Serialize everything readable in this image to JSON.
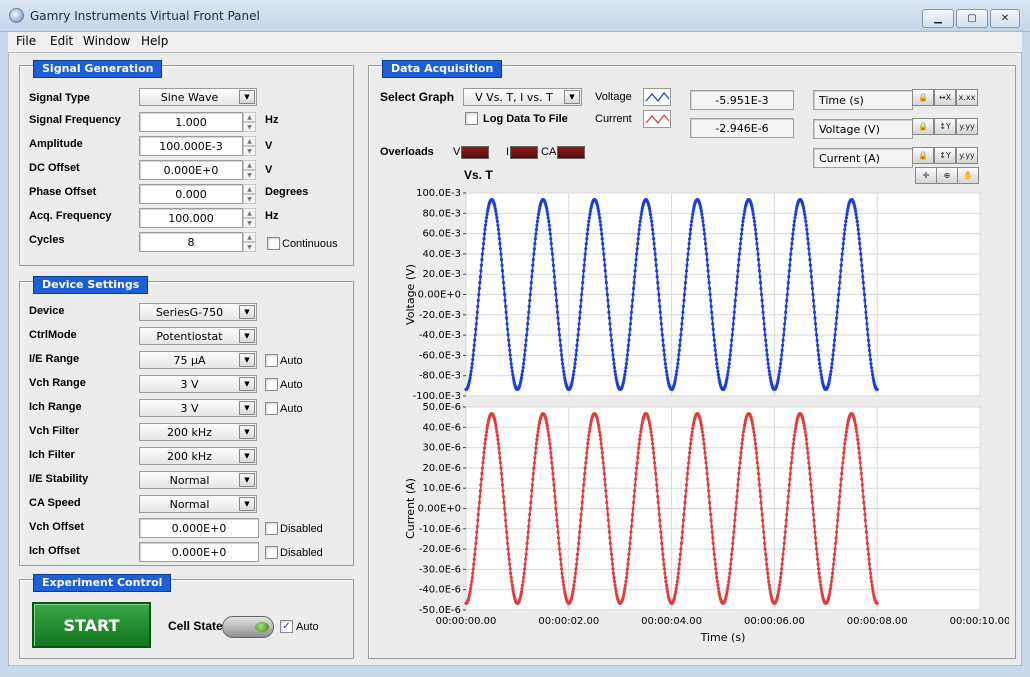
{
  "window": {
    "title": "Gamry Instruments Virtual Front Panel"
  },
  "menu": [
    "File",
    "Edit",
    "Window",
    "Help"
  ],
  "signal_generation": {
    "title": "Signal Generation",
    "signal_type": {
      "label": "Signal Type",
      "value": "Sine Wave"
    },
    "frequency": {
      "label": "Signal Frequency",
      "value": "1.000",
      "unit": "Hz"
    },
    "amplitude": {
      "label": "Amplitude",
      "value": "100.000E-3",
      "unit": "V"
    },
    "dc_offset": {
      "label": "DC Offset",
      "value": "0.000E+0",
      "unit": "V"
    },
    "phase_offset": {
      "label": "Phase Offset",
      "value": "0.000",
      "unit": "Degrees"
    },
    "acq_frequency": {
      "label": "Acq. Frequency",
      "value": "100.000",
      "unit": "Hz"
    },
    "cycles": {
      "label": "Cycles",
      "value": "8",
      "continuous_label": "Continuous"
    }
  },
  "device_settings": {
    "title": "Device Settings",
    "rows": [
      {
        "label": "Device",
        "value": "SeriesG-750",
        "type": "ring"
      },
      {
        "label": "CtrlMode",
        "value": "Potentiostat",
        "type": "ring"
      },
      {
        "label": "I/E Range",
        "value": "75 µA",
        "type": "ring",
        "check": "Auto"
      },
      {
        "label": "Vch Range",
        "value": "3 V",
        "type": "ring",
        "check": "Auto"
      },
      {
        "label": "Ich Range",
        "value": "3 V",
        "type": "ring",
        "check": "Auto"
      },
      {
        "label": "Vch Filter",
        "value": "200 kHz",
        "type": "ring"
      },
      {
        "label": "Ich Filter",
        "value": "200 kHz",
        "type": "ring"
      },
      {
        "label": "I/E Stability",
        "value": "Normal",
        "type": "ring"
      },
      {
        "label": "CA Speed",
        "value": "Normal",
        "type": "ring"
      },
      {
        "label": "Vch Offset",
        "value": "0.000E+0",
        "type": "num",
        "check": "Disabled"
      },
      {
        "label": "Ich Offset",
        "value": "0.000E+0",
        "type": "num",
        "check": "Disabled"
      }
    ]
  },
  "experiment_control": {
    "title": "Experiment Control",
    "start_label": "START",
    "cell_state_label": "Cell State",
    "auto_label": "Auto",
    "auto_checked": true
  },
  "data_acquisition": {
    "title": "Data Acquisition",
    "select_graph_label": "Select Graph",
    "select_graph_value": "V Vs. T, I vs. T",
    "log_label": "Log Data To File",
    "voltage_label": "Voltage",
    "current_label": "Current",
    "voltage_value": "-5.951E-3",
    "current_value": "-2.946E-6",
    "overloads_label": "Overloads",
    "overload_v": "V",
    "overload_i": "I",
    "overload_ca": "CA",
    "graph_title": "Vs. T",
    "axis_time": "Time (s)",
    "axis_voltage": "Voltage (V)",
    "axis_current": "Current (A)",
    "tool_x": "x.xx",
    "tool_y": "y.yy",
    "voltage_color": "#1a3fd6",
    "current_color": "#e03c3c"
  },
  "chart_data": [
    {
      "type": "scatter",
      "ylabel": "Voltage (V)",
      "xlim": [
        0,
        10
      ],
      "ylim": [
        -0.1,
        0.1
      ],
      "yticks": [
        "100.0E-3",
        "80.0E-3",
        "60.0E-3",
        "40.0E-3",
        "20.0E-3",
        "0.00E+0",
        "-20.0E-3",
        "-40.0E-3",
        "-60.0E-3",
        "-80.0E-3",
        "-100.0E-3"
      ],
      "series": [
        {
          "amplitude": 0.0935,
          "frequency_hz": 1.0,
          "phase_deg": -90,
          "x_start": 0,
          "x_end": 8.0,
          "sample_rate_hz": 100
        }
      ],
      "grid": true
    },
    {
      "type": "scatter",
      "xlabel": "Time (s)",
      "ylabel": "Current (A)",
      "xlim": [
        0,
        10
      ],
      "ylim": [
        -5e-05,
        5e-05
      ],
      "yticks": [
        "50.0E-6",
        "40.0E-6",
        "30.0E-6",
        "20.0E-6",
        "10.0E-6",
        "0.00E+0",
        "-10.0E-6",
        "-20.0E-6",
        "-30.0E-6",
        "-40.0E-6",
        "-50.0E-6"
      ],
      "xticks": [
        "00:00:00.00",
        "00:00:02.00",
        "00:00:04.00",
        "00:00:06.00",
        "00:00:08.00",
        "00:00:10.00"
      ],
      "series": [
        {
          "amplitude": 4.67e-05,
          "frequency_hz": 1.0,
          "phase_deg": -90,
          "x_start": 0,
          "x_end": 8.0,
          "sample_rate_hz": 100
        }
      ],
      "grid": true
    }
  ]
}
